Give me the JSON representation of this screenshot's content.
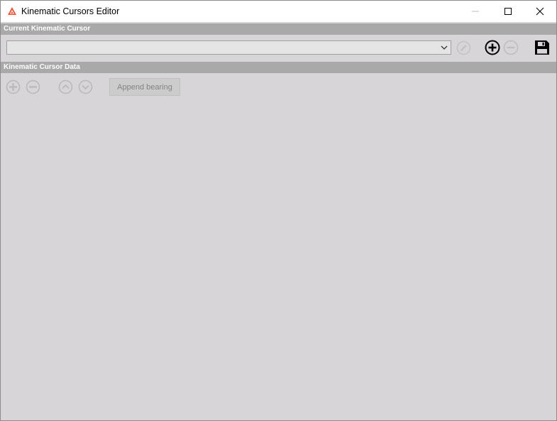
{
  "window": {
    "title": "Kinematic Cursors Editor",
    "icon": "app-logo-icon",
    "controls": [
      "minimize-icon",
      "maximize-icon",
      "close-icon"
    ],
    "accent_color": "#e8563a"
  },
  "current_cursor": {
    "header": "Current Kinematic Cursor",
    "selector_value": "",
    "icons": [
      "chevron-down-icon",
      "edit-pencil-icon",
      "add-circle-icon",
      "remove-circle-icon",
      "save-icon"
    ]
  },
  "cursor_data": {
    "header": "Kinematic Cursor Data",
    "icons": [
      "add-row-icon",
      "remove-row-icon",
      "move-up-icon",
      "move-down-icon"
    ],
    "append_label": "Append bearing"
  },
  "colors": {
    "header_bg": "#a9a9a9",
    "panel_bg": "#d8d5d8",
    "disabled_icon": "#b4b4b4"
  }
}
